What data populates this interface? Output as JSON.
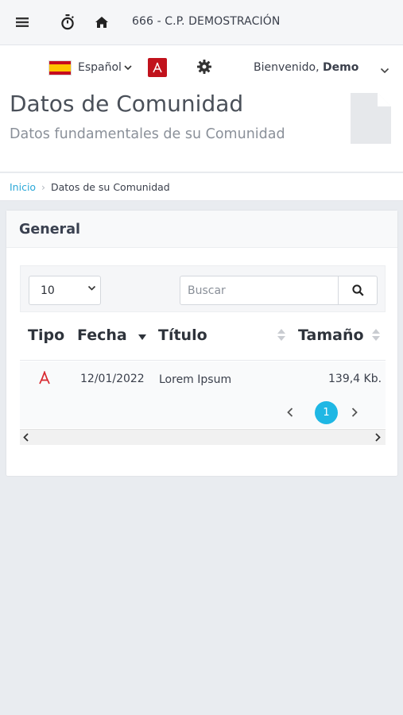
{
  "topbar": {
    "menu_icon": "hamburger-menu-icon",
    "timer_icon": "stopwatch-icon",
    "home_icon": "home-icon",
    "community_title": "666 - C.P. DEMOSTRACIÓN"
  },
  "userbar": {
    "language": "Español",
    "welcome_prefix": "Bienvenido, ",
    "user_name": "Demo"
  },
  "header": {
    "title": "Datos de Comunidad",
    "subtitle": "Datos fundamentales de su Comunidad"
  },
  "breadcrumb": {
    "home": "Inicio",
    "separator": "›",
    "current": "Datos de su Comunidad"
  },
  "panel": {
    "title": "General",
    "page_size": "10",
    "search_placeholder": "Buscar",
    "columns": {
      "type": "Tipo",
      "date": "Fecha",
      "title": "Título",
      "size": "Tamaño"
    },
    "rows": [
      {
        "type_icon": "pdf-icon",
        "date": "12/01/2022",
        "title": "Lorem Ipsum",
        "size": "139,4 Kb."
      }
    ],
    "pagination": {
      "current_page": "1"
    }
  },
  "colors": {
    "accent": "#1fb7e4",
    "link": "#2ba8d8",
    "pdf_red": "#c1121c",
    "background": "#e9ecf0"
  }
}
